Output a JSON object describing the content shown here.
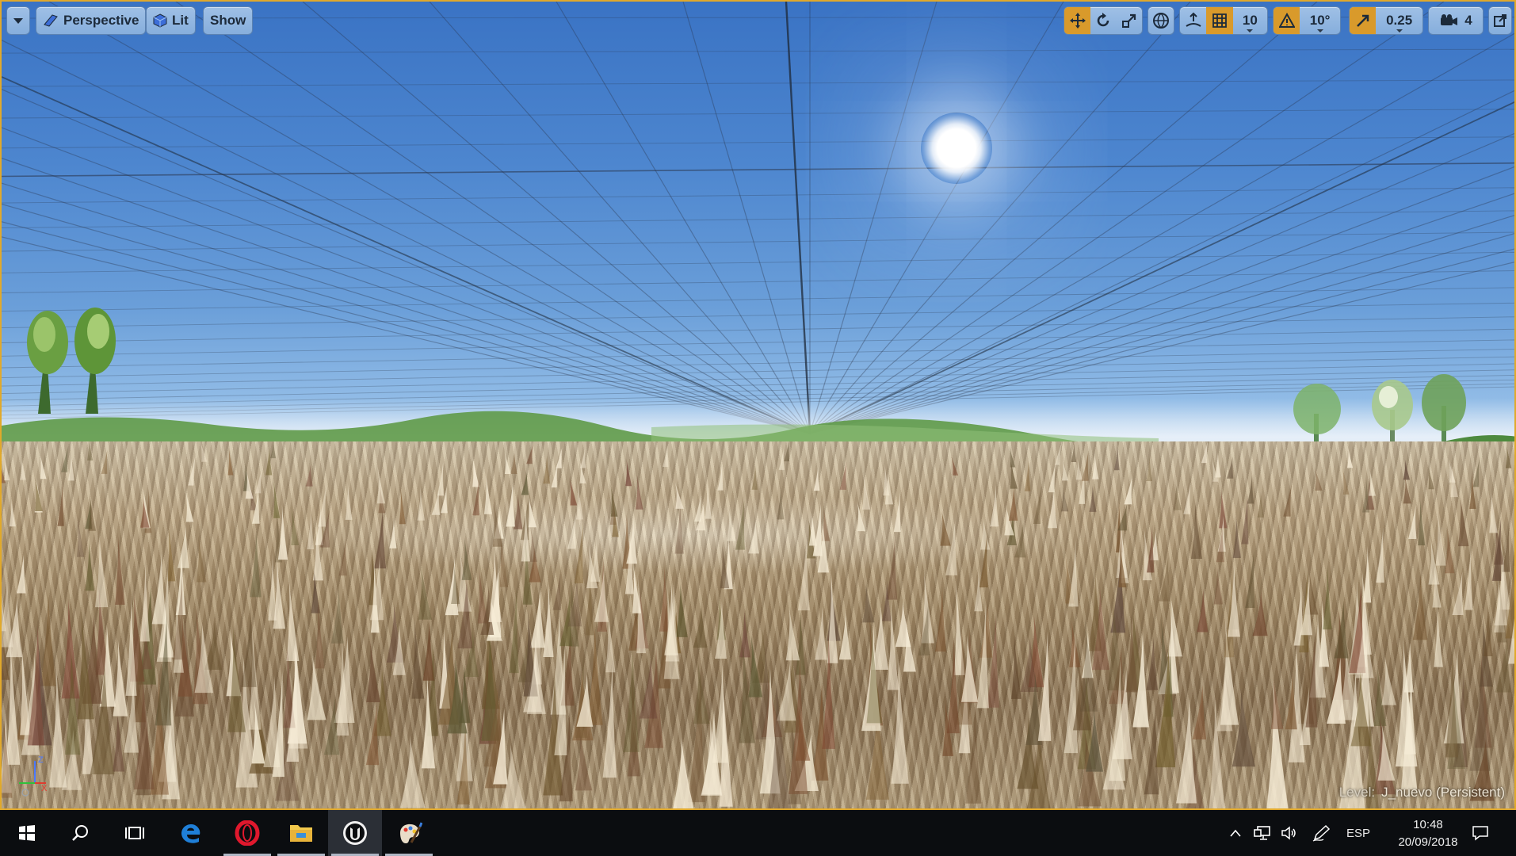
{
  "viewport": {
    "menu_label": "",
    "view_mode": "Perspective",
    "lighting_mode": "Lit",
    "show_label": "Show",
    "grid_snap_value": "10",
    "rotation_snap_value": "10°",
    "scale_snap_value": "0.25",
    "camera_speed_value": "4",
    "level_prefix": "Level:",
    "level_name": "J_nuevo (Persistent)",
    "axis_labels": {
      "z": "Z",
      "x": "X"
    },
    "icons": [
      "dropdown-icon",
      "perspective-cube-icon",
      "lit-cube-icon",
      "translate-icon",
      "rotate-icon",
      "scale-icon",
      "world-local-icon",
      "surface-snap-icon",
      "grid-snap-icon",
      "rotation-snap-icon",
      "scale-snap-icon",
      "camera-speed-icon",
      "maximize-icon"
    ]
  },
  "taskbar": {
    "apps": [
      {
        "name": "start",
        "icon": "windows-start-icon"
      },
      {
        "name": "search",
        "icon": "search-icon"
      },
      {
        "name": "task-view",
        "icon": "task-view-icon"
      },
      {
        "name": "edge",
        "icon": "edge-icon"
      },
      {
        "name": "opera",
        "icon": "opera-icon"
      },
      {
        "name": "file-explorer",
        "icon": "folder-icon"
      },
      {
        "name": "unreal-engine",
        "icon": "unreal-engine-icon"
      },
      {
        "name": "paint",
        "icon": "paint-icon"
      }
    ],
    "language": "ESP",
    "time": "10:48",
    "date": "20/09/2018"
  },
  "colors": {
    "toolbar_button": "#8fb4e0",
    "active_snap": "#d99a2b",
    "viewport_border": "#e1a92b",
    "taskbar": "#0b0d10"
  }
}
